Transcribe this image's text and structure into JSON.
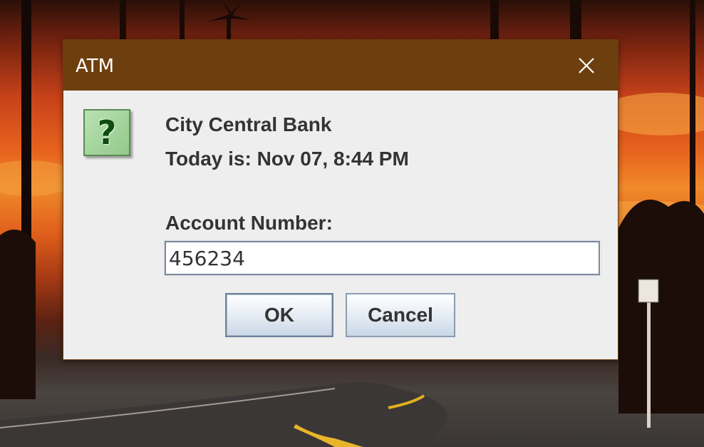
{
  "window": {
    "title": "ATM",
    "close_icon": "close-icon"
  },
  "dialog": {
    "icon": "question-icon",
    "icon_glyph": "?",
    "bank_name": "City Central Bank",
    "today_text": "Today is: Nov 07, 8:44 PM",
    "account_label": "Account Number:",
    "account_value": "456234",
    "ok_label": "OK",
    "cancel_label": "Cancel"
  },
  "colors": {
    "titlebar": "#6e3f0e",
    "dialog_bg": "#eeeeee",
    "icon_bg": "#93c98b",
    "text": "#333333"
  }
}
